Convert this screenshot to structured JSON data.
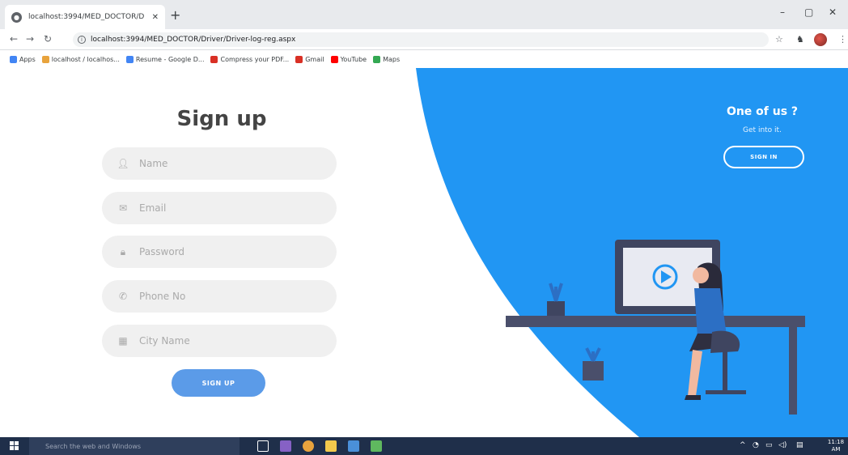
{
  "browser": {
    "tab_title": "localhost:3994/MED_DOCTOR/D",
    "url": "localhost:3994/MED_DOCTOR/Driver/Driver-log-reg.aspx",
    "bookmarks": [
      {
        "label": "Apps",
        "color": "#4285f4"
      },
      {
        "label": "localhost / localhos...",
        "color": "#e8a33d"
      },
      {
        "label": "Resume - Google D...",
        "color": "#4285f4"
      },
      {
        "label": "Compress your PDF...",
        "color": "#d93025"
      },
      {
        "label": "Gmail",
        "color": "#d93025"
      },
      {
        "label": "YouTube",
        "color": "#ff0000"
      },
      {
        "label": "Maps",
        "color": "#34a853"
      }
    ]
  },
  "signup": {
    "title": "Sign up",
    "fields": {
      "name": "Name",
      "email": "Email",
      "password": "Password",
      "phone": "Phone No",
      "city": "City Name"
    },
    "button": "SIGN UP"
  },
  "side": {
    "heading": "One of us ?",
    "sub": "Get into it.",
    "button": "SIGN IN"
  },
  "taskbar": {
    "search_placeholder": "Search the web and Windows",
    "time": "11:18 AM"
  },
  "colors": {
    "accent_blue": "#2196f3",
    "button_blue": "#5b9be8"
  }
}
